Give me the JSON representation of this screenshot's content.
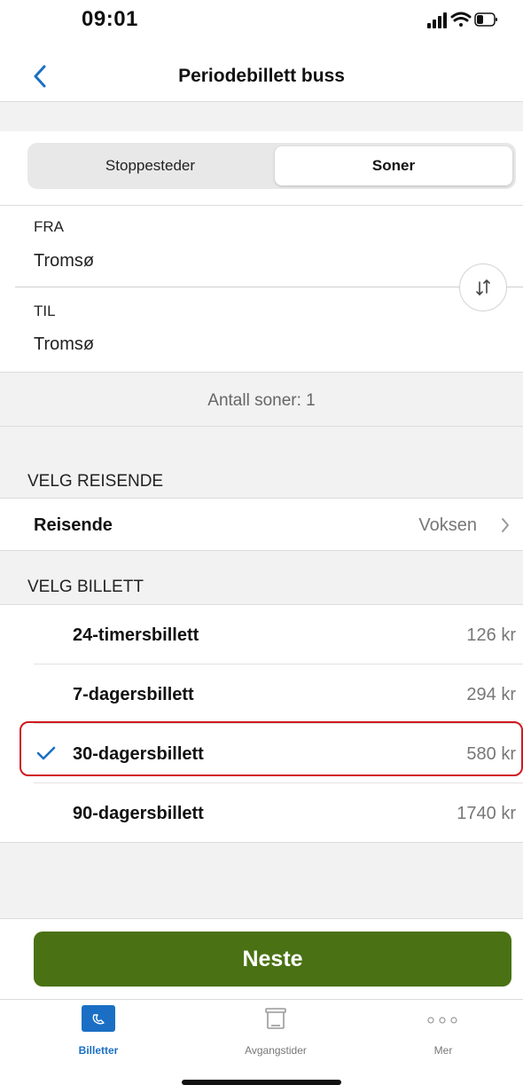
{
  "status_bar": {
    "time": "09:01"
  },
  "nav": {
    "title": "Periodebillett buss"
  },
  "segment": {
    "left_label": "Stoppesteder",
    "right_label": "Soner",
    "selected": "Soner"
  },
  "route": {
    "from_label": "FRA",
    "from_value": "Tromsø",
    "to_label": "TIL",
    "to_value": "Tromsø",
    "zones_text": "Antall soner: 1"
  },
  "traveller": {
    "section_title": "VELG REISENDE",
    "label": "Reisende",
    "value": "Voksen"
  },
  "tickets": {
    "section_title": "VELG BILLETT",
    "items": [
      {
        "label": "24-timersbillett",
        "price": "126 kr",
        "selected": false
      },
      {
        "label": "7-dagersbillett",
        "price": "294 kr",
        "selected": false
      },
      {
        "label": "30-dagersbillett",
        "price": "580 kr",
        "selected": true
      },
      {
        "label": "90-dagersbillett",
        "price": "1740 kr",
        "selected": false
      }
    ]
  },
  "cta": {
    "label": "Neste"
  },
  "tabbar": {
    "items": [
      {
        "label": "Billetter",
        "icon": "ticket-icon",
        "active": true
      },
      {
        "label": "Avgangstider",
        "icon": "bus-stop-icon",
        "active": false
      },
      {
        "label": "Mer",
        "icon": "more-icon",
        "active": false
      }
    ]
  },
  "colors": {
    "accent": "#1a6fc4",
    "cta": "#4a7214",
    "highlight": "#d0191f"
  }
}
